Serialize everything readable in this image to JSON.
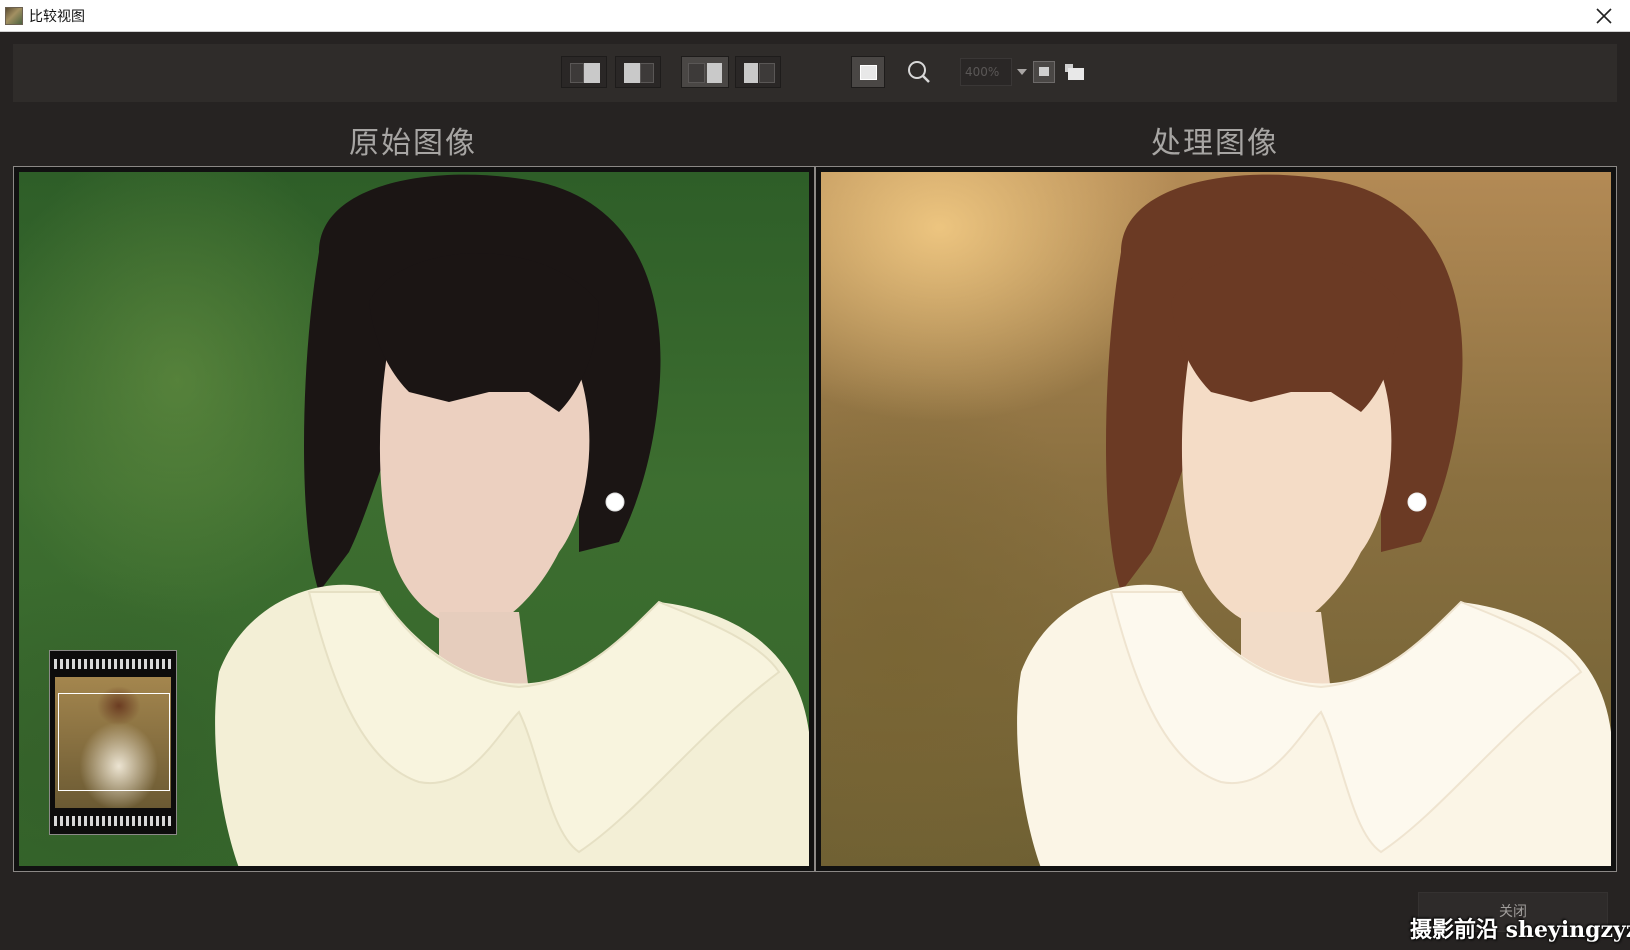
{
  "window": {
    "title": "比较视图"
  },
  "toolbar": {
    "zoom_value": "400%"
  },
  "panels": {
    "left_heading": "原始图像",
    "right_heading": "处理图像"
  },
  "footer": {
    "close_label": "关闭",
    "watermark": "摄影前沿 sheyingzyz.com"
  }
}
